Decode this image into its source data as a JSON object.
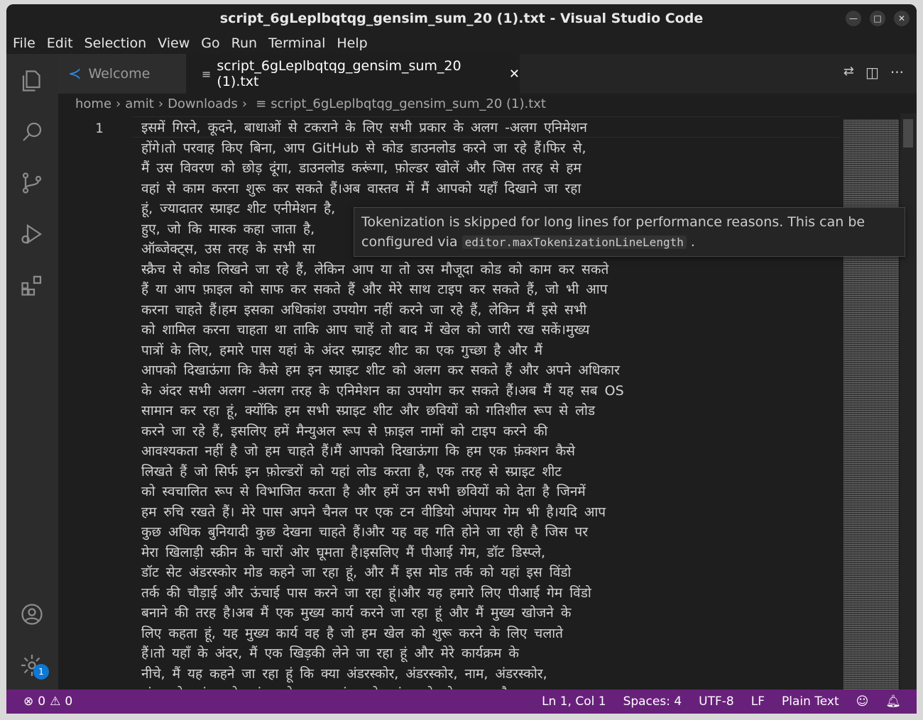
{
  "window": {
    "title": "script_6gLeplbqtqg_gensim_sum_20 (1).txt - Visual Studio Code"
  },
  "menu": [
    "File",
    "Edit",
    "Selection",
    "View",
    "Go",
    "Run",
    "Terminal",
    "Help"
  ],
  "tabs": [
    {
      "label": "Welcome",
      "active": false
    },
    {
      "label": "script_6gLeplbqtqg_gensim_sum_20 (1).txt",
      "active": true
    }
  ],
  "breadcrumb": [
    "home",
    "amit",
    "Downloads",
    "script_6gLeplbqtqg_gensim_sum_20 (1).txt"
  ],
  "editor": {
    "line_number": "1",
    "lines": [
      "इसमें गिरने, कूदने, बाधाओं से टकराने के लिए सभी प्रकार के अलग -अलग एनिमेशन",
      "होंगे।तो परवाह किए बिना, आप GitHub से कोड डाउनलोड करने जा रहे हैं।फिर से,",
      "मैं उस विवरण को छोड़ दूंगा, डाउनलोड करूंगा, फ़ोल्डर खोलें और जिस तरह से हम",
      "वहां से काम करना शुरू कर सकते हैं।अब वास्तव में मैं आपको यहाँ दिखाने जा रहा",
      "हूं, ज्यादातर स्प्राइट शीट एनीमेशन है,",
      "हुए, जो कि मास्क कहा जाता है,",
      "ऑब्जेक्ट्स, उस तरह के सभी सा",
      "स्क्रैच से कोड लिखने जा रहे हैं, लेकिन आप या तो उस मौजूदा कोड को काम कर सकते",
      "हैं या आप फ़ाइल को साफ कर सकते हैं और मेरे साथ टाइप कर सकते हैं, जो भी आप",
      "करना चाहते हैं।हम इसका अधिकांश उपयोग नहीं करने जा रहे हैं, लेकिन मैं इसे सभी",
      "को शामिल करना चाहता था ताकि आप चाहें तो बाद में खेल को जारी रख सकें।मुख्य",
      "पात्रों के लिए, हमारे पास यहां के अंदर स्प्राइट शीट का एक गुच्छा है और मैं",
      "आपको दिखाऊंगा कि कैसे हम इन स्प्राइट शीट को अलग कर सकते हैं और अपने अधिकार",
      "के अंदर सभी अलग -अलग तरह के एनिमेशन का उपयोग कर सकते हैं।अब मैं यह सब OS",
      "सामान कर रहा हूं, क्योंकि हम सभी स्प्राइट शीट और छवियों को गतिशील रूप से लोड",
      "करने जा रहे हैं, इसलिए हमें मैन्युअल रूप से फ़ाइल नामों को टाइप करने की",
      "आवश्यकता नहीं है जो हम चाहते हैं।मैं आपको दिखाऊंगा कि हम एक फ़ंक्शन कैसे",
      "लिखते हैं जो सिर्फ इन फ़ोल्डरों को यहां लोड करता है, एक तरह से स्प्राइट शीट",
      "को स्वचालित रूप से विभाजित करता है और हमें उन सभी छवियों को देता है जिनमें",
      "हम रुचि रखते हैं। मेरे पास अपने चैनल पर एक टन वीडियो अंपायर गेम भी है।यदि आप",
      "कुछ अधिक बुनियादी कुछ देखना चाहते हैं।और यह वह गति होने जा रही है जिस पर",
      "मेरा खिलाड़ी स्क्रीन के चारों ओर घूमता है।इसलिए मैं पीआई गेम, डॉट डिस्प्ले,",
      "डॉट सेट अंडरस्कोर मोड कहने जा रहा हूं, और मैं इस मोड तर्क को यहां इस विंडो",
      "तर्क की चौड़ाई और ऊंचाई पास करने जा रहा हूं।और यह हमारे लिए पीआई गेम विंडो",
      "बनाने की तरह है।अब मैं एक मुख्य कार्य करने जा रहा हूं और मैं मुख्य खोजने के",
      "लिए कहता हूं, यह मुख्य कार्य वह है जो हम खेल को शुरू करने के लिए चलाते",
      "हैं।तो यहाँ के अंदर, मैं एक खिड़की लेने जा रहा हूं और मेरे कार्यक्रम के",
      "नीचे, मैं यह कहने जा रहा हूं कि क्या अंडरस्कोर, अंडरस्कोर, नाम, अंडरस्कोर,",
      "अंडरस्कोर अंडरस्कोर अंडरस्कोर मुख्य अंडरस्कोर अंडरस्कोर के बराबर है"
    ]
  },
  "hover": {
    "text_before": "Tokenization is skipped for long lines for performance reasons. This can be configured via",
    "code": "editor.maxTokenizationLineLength",
    "text_after": "."
  },
  "status": {
    "errors": "0",
    "warnings": "0",
    "position": "Ln 1, Col 1",
    "spaces": "Spaces: 4",
    "encoding": "UTF-8",
    "eol": "LF",
    "language": "Plain Text"
  },
  "badge_count": "1",
  "colors": {
    "statusbar": "#68217a",
    "accent": "#0e78d5"
  }
}
